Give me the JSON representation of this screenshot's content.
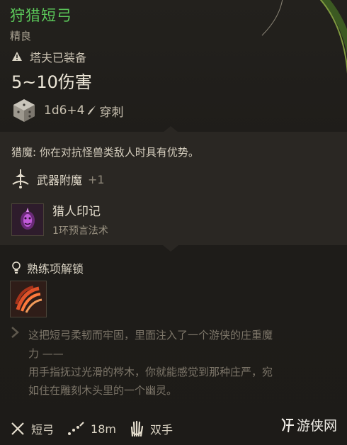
{
  "item": {
    "name": "狩猎短弓",
    "rarity": "精良",
    "equipped_by": "塔夫已装备",
    "damage": "5~10伤害",
    "dice": "1d6+4",
    "damage_type": "穿刺"
  },
  "passive": {
    "text": "猎魔: 你在对抗怪兽类敌人时具有优势。"
  },
  "enchant": {
    "label": "武器附魔",
    "bonus": "+1"
  },
  "spell": {
    "name": "猎人印记",
    "level": "1环预言法术"
  },
  "proficiency": {
    "label": "熟练项解锁"
  },
  "lore": {
    "line1": "这把短弓柔韧而牢固，里面注入了一个游侠的庄重魔",
    "line2": "力 ——",
    "line3": "用手指抚过光滑的梣木，你就能感觉到那种庄严，宛",
    "line4": "如住在雕刻木头里的一个幽灵。"
  },
  "footer": {
    "weapon_type": "短弓",
    "range": "18m",
    "handedness": "双手"
  },
  "watermark": {
    "text": "游侠网"
  },
  "colors": {
    "title_green": "#5bc85a",
    "panel_bg": "#2a2723",
    "spell_purple": "#c05ad8",
    "prof_orange": "#e0532a"
  }
}
